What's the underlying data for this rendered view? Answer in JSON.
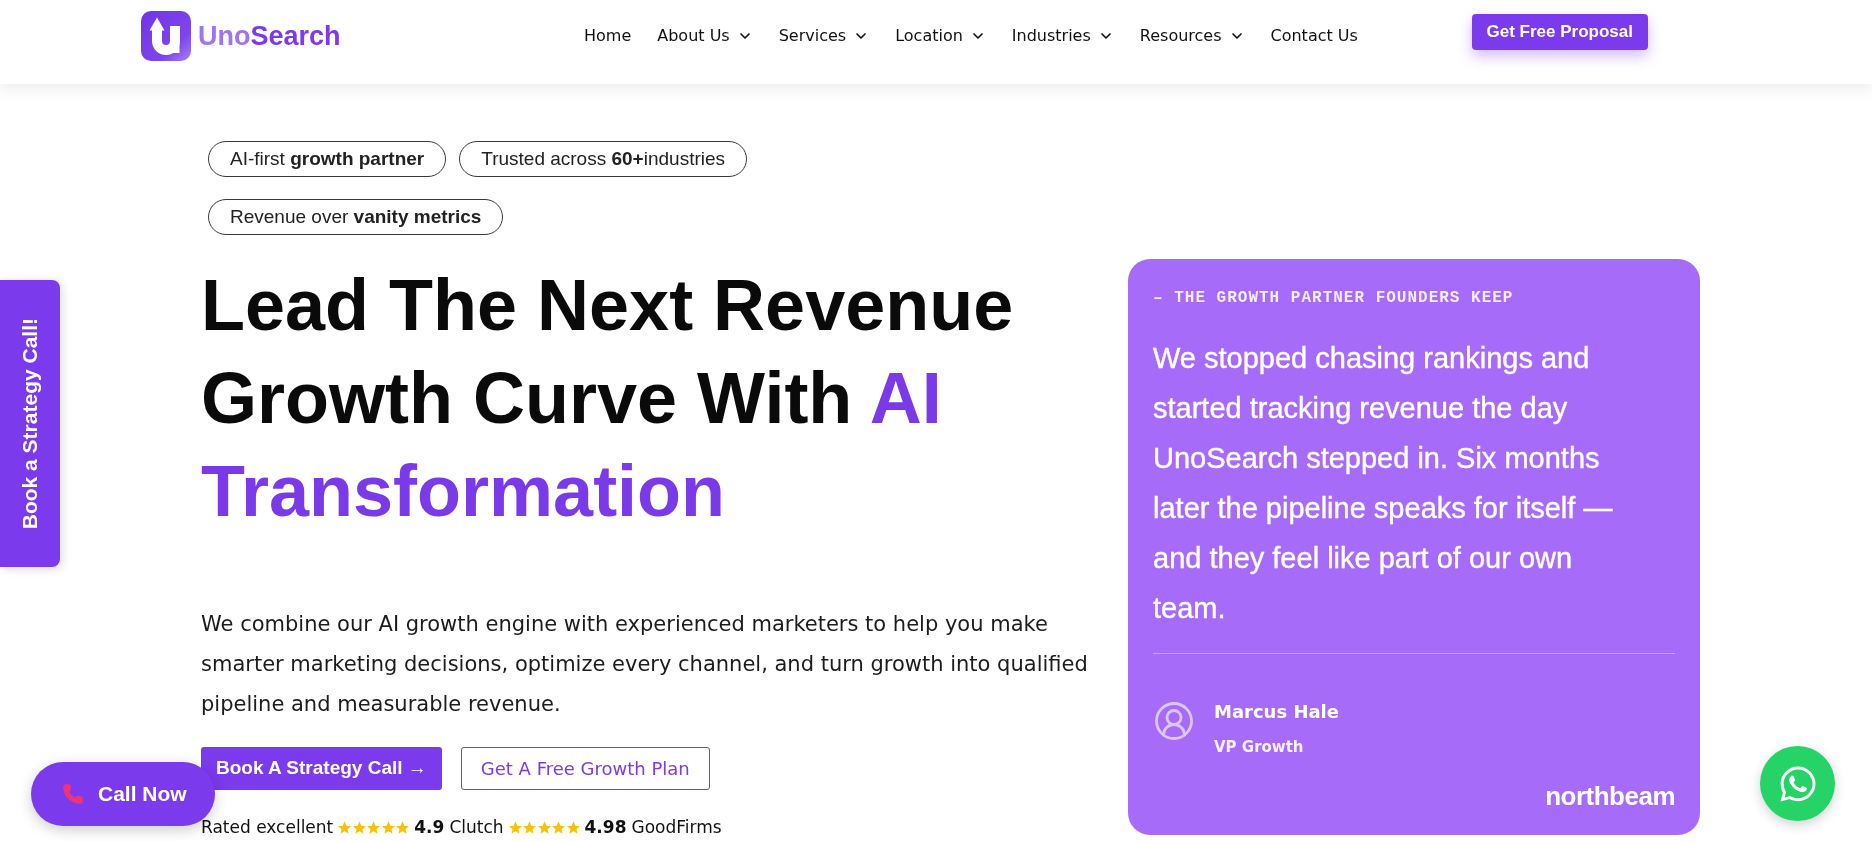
{
  "header": {
    "logo": {
      "text_light": "Uno",
      "text_dark": "Search"
    },
    "nav": [
      {
        "label": "Home",
        "has_menu": false
      },
      {
        "label": "About Us",
        "has_menu": true
      },
      {
        "label": "Services",
        "has_menu": true
      },
      {
        "label": "Location",
        "has_menu": true
      },
      {
        "label": "Industries",
        "has_menu": true
      },
      {
        "label": "Resources",
        "has_menu": true
      },
      {
        "label": "Contact Us",
        "has_menu": false
      }
    ],
    "cta": "Get Free Proposal"
  },
  "side_tab": {
    "label": "Book a Strategy Call!"
  },
  "hero": {
    "badges": [
      "AI-first **growth partner**",
      "Trusted across **60+**industries",
      "Revenue over **vanity metrics**"
    ],
    "heading": {
      "text": "Lead The Next Revenue Growth Curve With",
      "highlight": "AI Transformation"
    },
    "description": "We combine our AI growth engine with experienced marketers to help you make smarter marketing decisions, optimize every channel, and turn growth into qualified pipeline and measurable revenue.",
    "buttons": [
      {
        "label": "Book A Strategy Call →",
        "kind": "primary"
      },
      {
        "label": "Get A Free Growth Plan",
        "kind": "outline"
      }
    ],
    "rating": {
      "label": "Rated excellent",
      "sources": [
        {
          "stars": 5,
          "score": "4.9",
          "name": "Clutch"
        },
        {
          "stars": 5,
          "score": "4.98",
          "name": "GoodFirms"
        }
      ]
    }
  },
  "testimonial": {
    "eyebrow": "– THE GROWTH PARTNER FOUNDERS KEEP",
    "quote": "We stopped chasing rankings and started tracking revenue the day UnoSearch stepped in. Six months later the pipeline speaks for itself — and they feel like part of our own team.",
    "author": {
      "name": "Marcus Hale",
      "role": "VP Growth"
    },
    "company": "northbeam"
  },
  "floating": {
    "call_label": "Call Now"
  }
}
